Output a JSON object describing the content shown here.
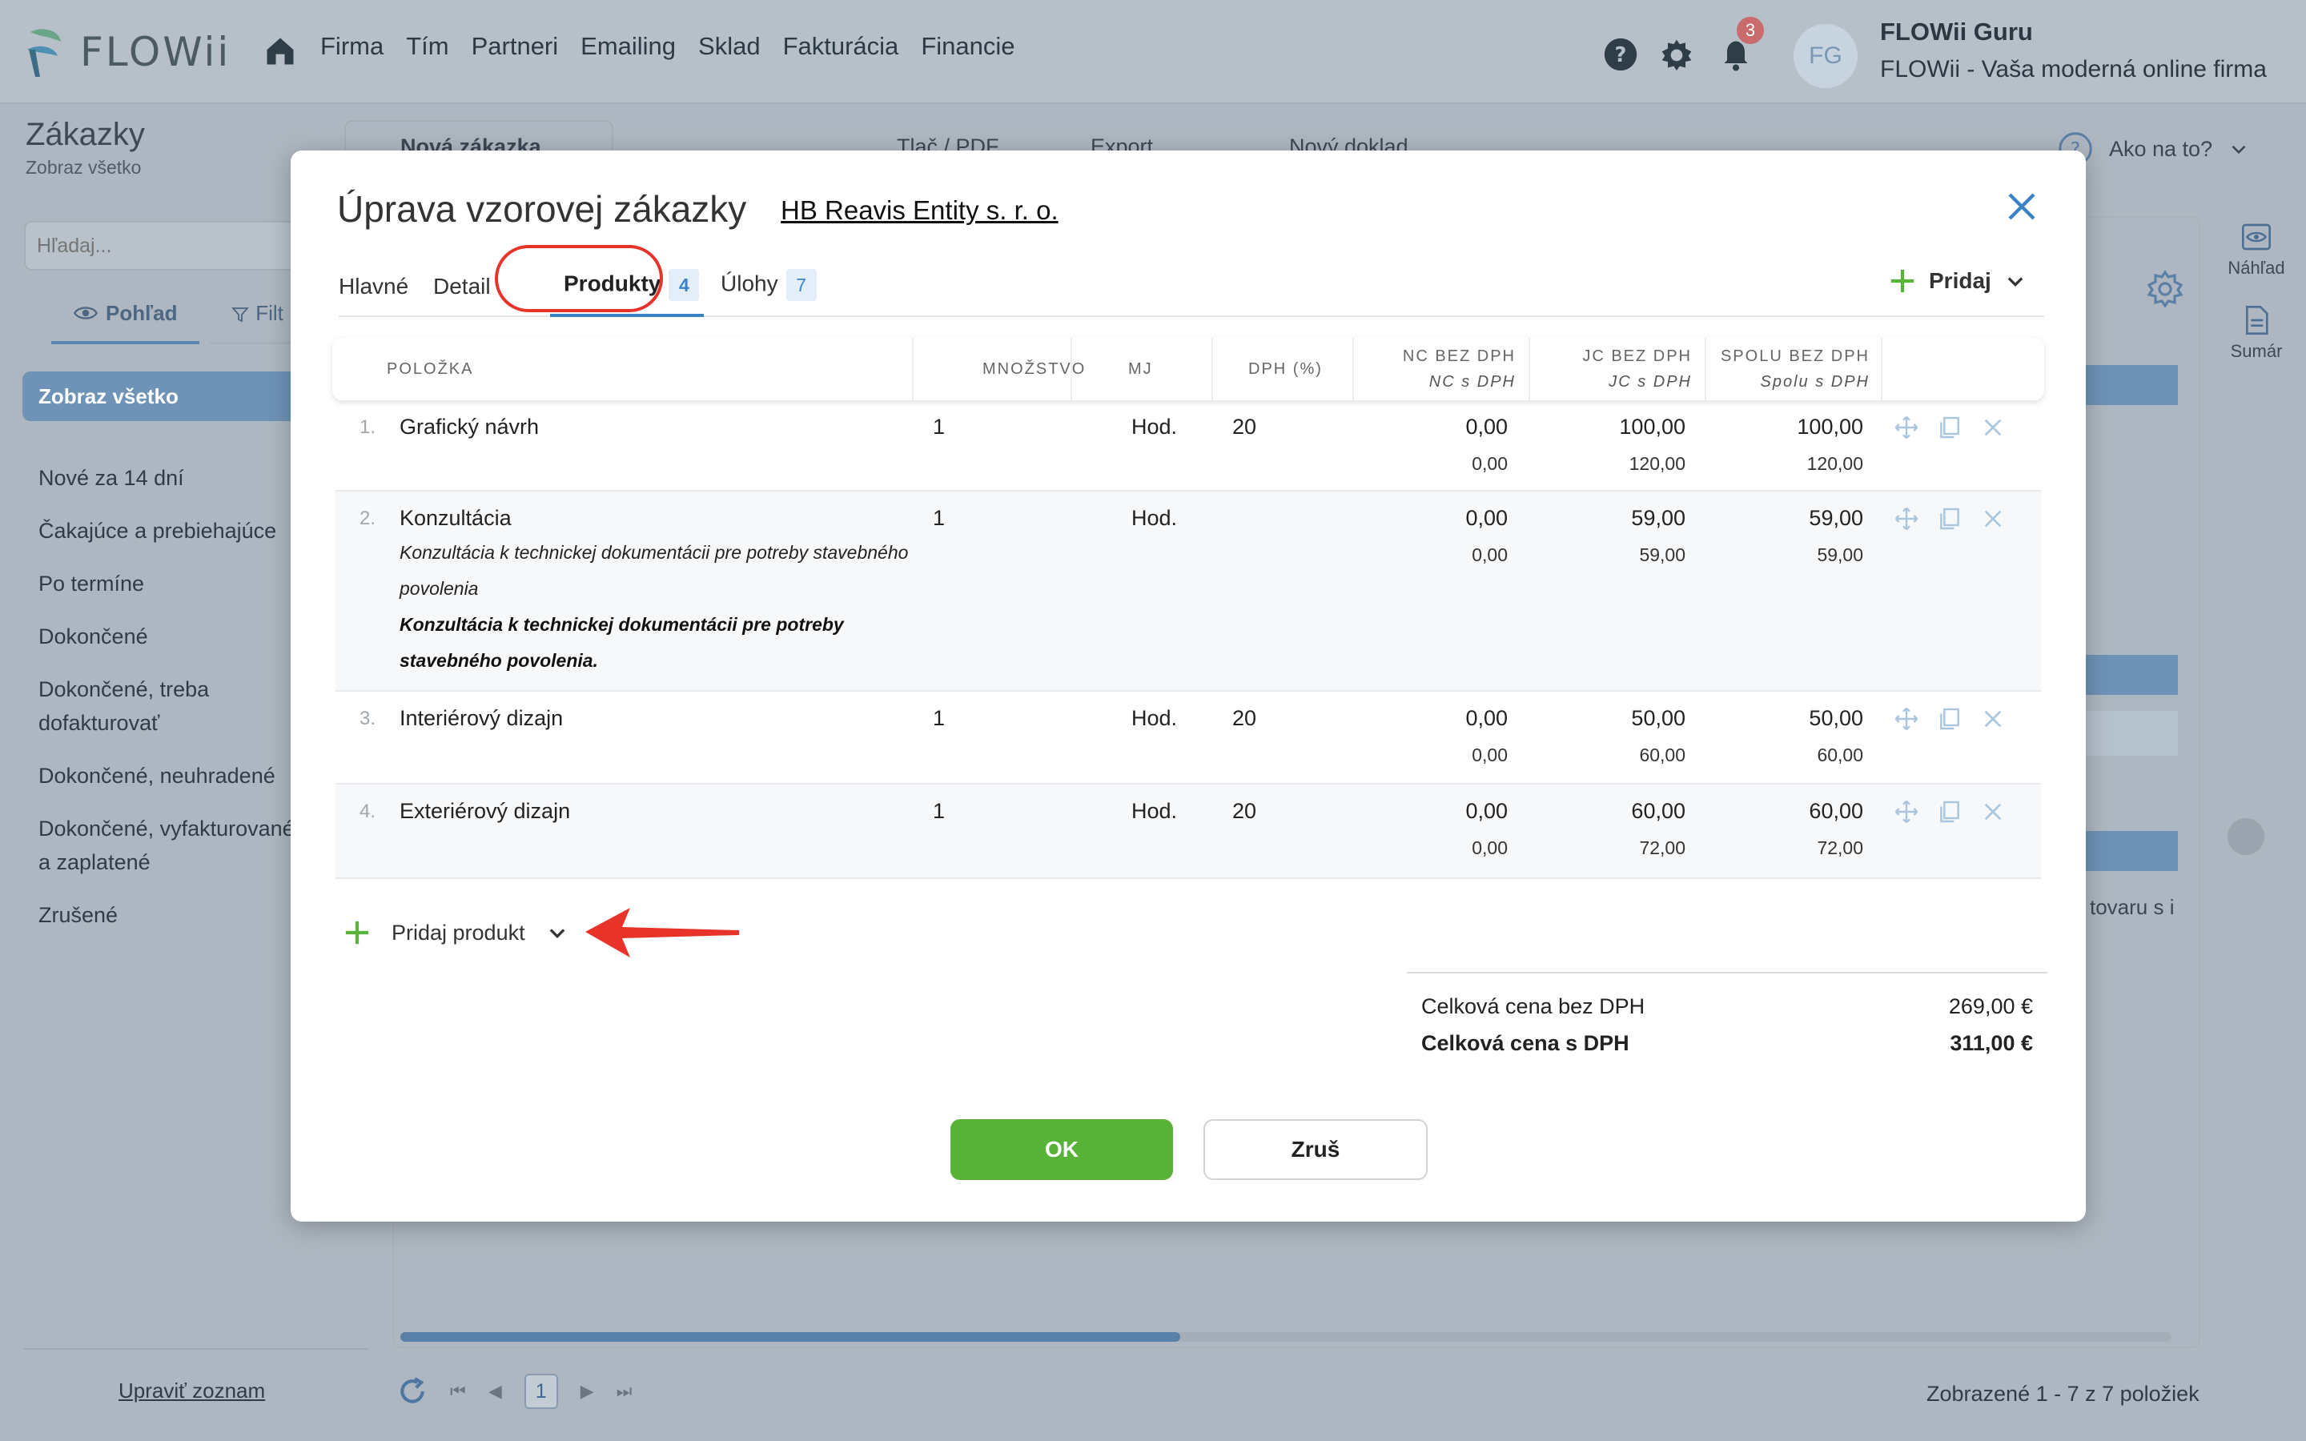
{
  "app": {
    "logo_text": "FLOWii",
    "nav": [
      "Firma",
      "Tím",
      "Partneri",
      "Emailing",
      "Sklad",
      "Fakturácia",
      "Financie"
    ],
    "notifications_count": "3",
    "user_initials": "FG",
    "user_name": "FLOWii Guru",
    "user_company": "FLOWii - Vaša moderná online firma"
  },
  "page": {
    "title": "Zákazky",
    "subtitle": "Zobraz všetko",
    "toolbar": {
      "new_order": "Nová zákazka",
      "print": "Tlač / PDF",
      "export": "Export",
      "new_document": "Nový doklad"
    },
    "help_label": "Ako na to?"
  },
  "sidebar": {
    "search_placeholder": "Hľadaj...",
    "view_tab": "Pohľad",
    "filter_tab": "Filt",
    "active_item": "Zobraz všetko",
    "items": [
      "Nové za 14 dní",
      "Čakajúce a prebiehajúce",
      "Po termíne",
      "Dokončené",
      "Dokončené, treba dofakturovať",
      "Dokončené, neuhradené",
      "Dokončené, vyfakturované a zaplatené",
      "Zrušené"
    ],
    "edit_list": "Upraviť zoznam"
  },
  "right_panel": {
    "preview": "Náhľad",
    "summary": "Sumár",
    "ghost_text": "tovaru s i"
  },
  "pager": {
    "current_page": "1",
    "info": "Zobrazené 1 - 7 z 7 položiek"
  },
  "modal": {
    "title": "Úprava vzorovej zákazky",
    "client_link": "HB Reavis Entity s. r. o.",
    "tabs": [
      {
        "label": "Hlavné"
      },
      {
        "label": "Detail"
      },
      {
        "label": "Produkty",
        "count": "4"
      },
      {
        "label": "Úlohy",
        "count": "7"
      }
    ],
    "add_label": "Pridaj",
    "columns": {
      "item": "POLOŽKA",
      "quantity": "MNOŽSTVO",
      "unit": "MJ",
      "vat": "DPH (%)",
      "nc": "NC BEZ DPH",
      "nc_sub": "NC s DPH",
      "jc": "JC BEZ DPH",
      "jc_sub": "JC s DPH",
      "total": "SPOLU BEZ DPH",
      "total_sub": "Spolu s DPH"
    },
    "rows": [
      {
        "index": "1.",
        "name": "Grafický návrh",
        "qty": "1",
        "unit": "Hod.",
        "vat": "20",
        "nc": "0,00",
        "nc_vat": "0,00",
        "jc": "100,00",
        "jc_vat": "120,00",
        "total": "100,00",
        "total_vat": "120,00"
      },
      {
        "index": "2.",
        "name": "Konzultácia",
        "desc": "Konzultácia k technickej dokumentácii pre potreby stavebného povolenia",
        "desc_bold": "Konzultácia k technickej dokumentácii pre potreby stavebného povolenia.",
        "qty": "1",
        "unit": "Hod.",
        "vat": "",
        "nc": "0,00",
        "nc_vat": "0,00",
        "jc": "59,00",
        "jc_vat": "59,00",
        "total": "59,00",
        "total_vat": "59,00"
      },
      {
        "index": "3.",
        "name": "Interiérový dizajn",
        "qty": "1",
        "unit": "Hod.",
        "vat": "20",
        "nc": "0,00",
        "nc_vat": "0,00",
        "jc": "50,00",
        "jc_vat": "60,00",
        "total": "50,00",
        "total_vat": "60,00"
      },
      {
        "index": "4.",
        "name": "Exteriérový dizajn",
        "qty": "1",
        "unit": "Hod.",
        "vat": "20",
        "nc": "0,00",
        "nc_vat": "0,00",
        "jc": "60,00",
        "jc_vat": "72,00",
        "total": "60,00",
        "total_vat": "72,00"
      }
    ],
    "add_product": "Pridaj produkt",
    "totals": {
      "without_vat_label": "Celková cena bez DPH",
      "without_vat_value": "269,00 €",
      "with_vat_label": "Celková cena s DPH",
      "with_vat_value": "311,00 €"
    },
    "ok_label": "OK",
    "cancel_label": "Zruš"
  },
  "colors": {
    "accent_blue": "#3b82c4",
    "ok_green": "#5ab339",
    "highlight_red": "#e8332a",
    "overlay_bg": "#aeb7c1"
  }
}
